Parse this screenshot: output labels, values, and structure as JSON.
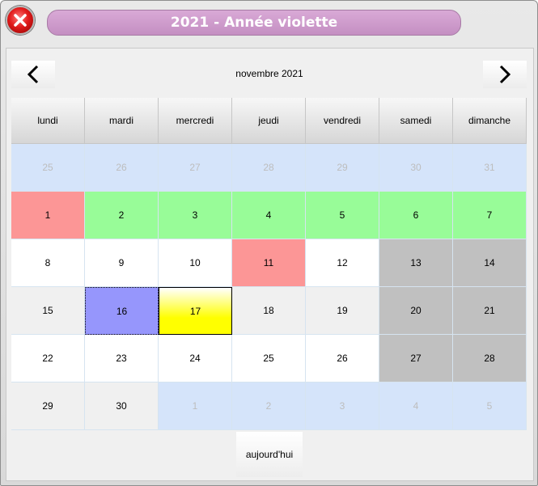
{
  "window": {
    "title": "2021 - Année violette"
  },
  "calendar": {
    "month_label": "novembre 2021",
    "weekdays": [
      "lundi",
      "mardi",
      "mercredi",
      "jeudi",
      "vendredi",
      "samedi",
      "dimanche"
    ],
    "weeks": [
      [
        "25",
        "26",
        "27",
        "28",
        "29",
        "30",
        "31"
      ],
      [
        "1",
        "2",
        "3",
        "4",
        "5",
        "6",
        "7"
      ],
      [
        "8",
        "9",
        "10",
        "11",
        "12",
        "13",
        "14"
      ],
      [
        "15",
        "16",
        "17",
        "18",
        "19",
        "20",
        "21"
      ],
      [
        "22",
        "23",
        "24",
        "25",
        "26",
        "27",
        "28"
      ],
      [
        "29",
        "30",
        "1",
        "2",
        "3",
        "4",
        "5"
      ]
    ],
    "today_button": "aujourd'hui",
    "colors": {
      "title_pill": "#c896c8",
      "out_of_month": "#d5e4fa",
      "green": "#98fc98",
      "red": "#fc9696",
      "weekend_gray": "#c0c0c0",
      "selected_blue": "#9696fc",
      "today_yellow": "#ffff00"
    }
  },
  "icons": {
    "close": "close-icon",
    "prev": "chevron-left-icon",
    "next": "chevron-right-icon"
  }
}
